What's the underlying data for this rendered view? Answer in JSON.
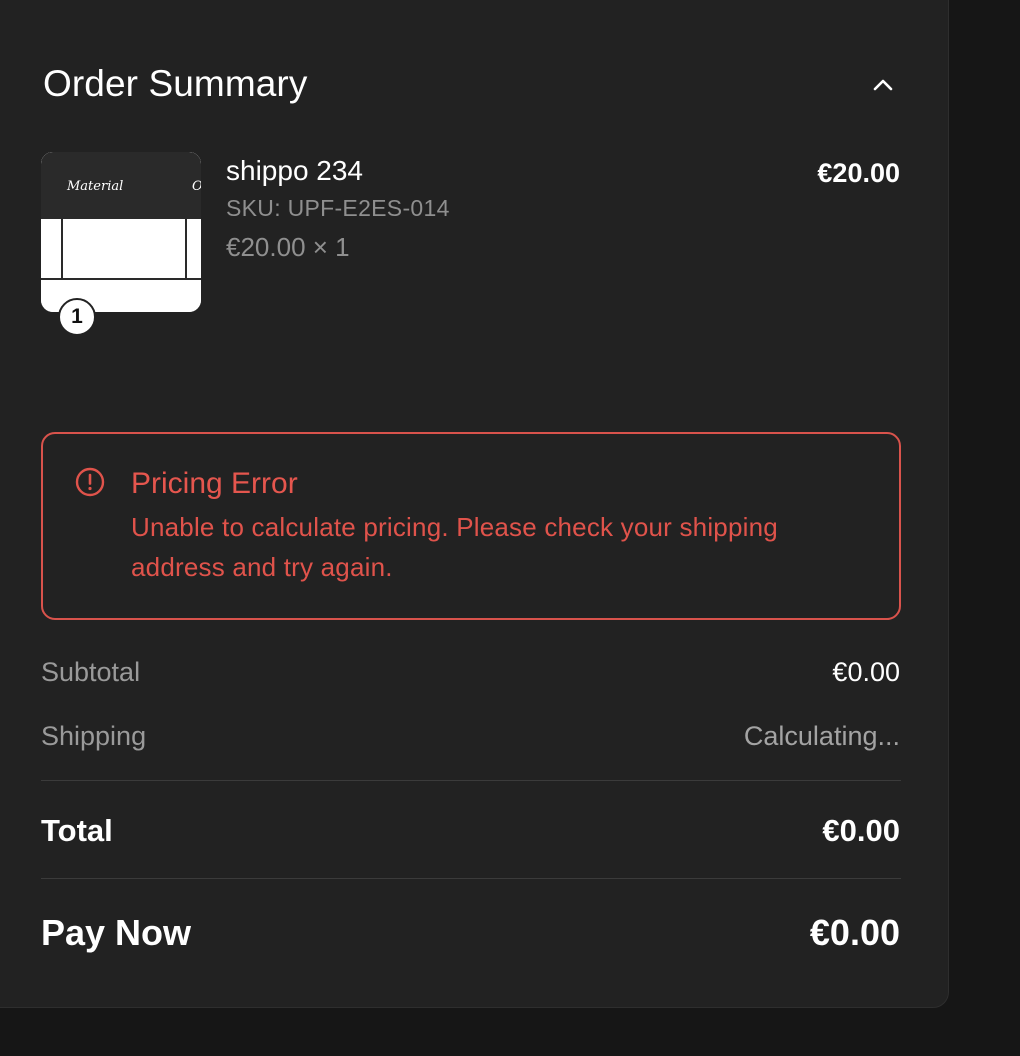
{
  "header": {
    "title": "Order Summary",
    "collapse_icon": "chevron-up-icon"
  },
  "item": {
    "name": "shippo 234",
    "sku": "SKU: UPF-E2ES-014",
    "unit_price_qty": "€20.00 × 1",
    "line_total": "€20.00",
    "quantity_badge": "1",
    "thumbnail_text": "Material",
    "thumbnail_text_cut": "O"
  },
  "error": {
    "icon": "alert-circle-icon",
    "title": "Pricing Error",
    "message": "Unable to calculate pricing. Please check your shipping address and try again.",
    "color": "#e0534b"
  },
  "summary": {
    "subtotal_label": "Subtotal",
    "subtotal_value": "€0.00",
    "shipping_label": "Shipping",
    "shipping_value": "Calculating...",
    "total_label": "Total",
    "total_value": "€0.00",
    "pay_label": "Pay Now",
    "pay_value": "€0.00"
  },
  "colors": {
    "panel_bg": "#222222",
    "page_bg": "#161616",
    "error": "#e0534b"
  }
}
